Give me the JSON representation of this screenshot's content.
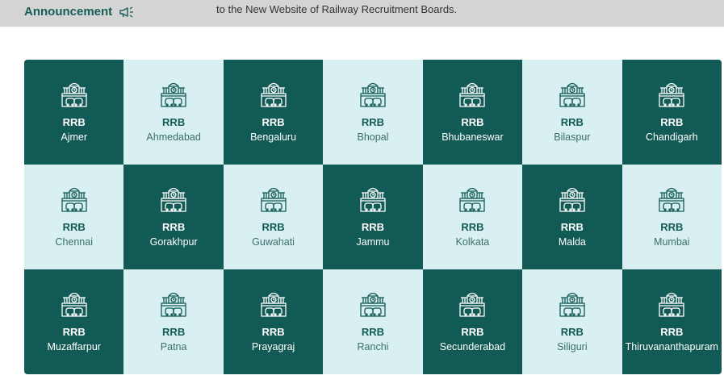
{
  "announcement": {
    "title": "Announcement",
    "icon": "megaphone-icon",
    "text": "to the New Website of Railway Recruitment Boards."
  },
  "colors": {
    "dark": "#125a55",
    "light": "#d9f0f2",
    "accent": "#165e56"
  },
  "boards": [
    {
      "prefix": "RRB",
      "city": "Ajmer",
      "theme": "dark"
    },
    {
      "prefix": "RRB",
      "city": "Ahmedabad",
      "theme": "light"
    },
    {
      "prefix": "RRB",
      "city": "Bengaluru",
      "theme": "dark"
    },
    {
      "prefix": "RRB",
      "city": "Bhopal",
      "theme": "light"
    },
    {
      "prefix": "RRB",
      "city": "Bhubaneswar",
      "theme": "dark"
    },
    {
      "prefix": "RRB",
      "city": "Bilaspur",
      "theme": "light"
    },
    {
      "prefix": "RRB",
      "city": "Chandigarh",
      "theme": "dark"
    },
    {
      "prefix": "RRB",
      "city": "Chennai",
      "theme": "light"
    },
    {
      "prefix": "RRB",
      "city": "Gorakhpur",
      "theme": "dark"
    },
    {
      "prefix": "RRB",
      "city": "Guwahati",
      "theme": "light"
    },
    {
      "prefix": "RRB",
      "city": "Jammu",
      "theme": "dark"
    },
    {
      "prefix": "RRB",
      "city": "Kolkata",
      "theme": "light"
    },
    {
      "prefix": "RRB",
      "city": "Malda",
      "theme": "dark"
    },
    {
      "prefix": "RRB",
      "city": "Mumbai",
      "theme": "light"
    },
    {
      "prefix": "RRB",
      "city": "Muzaffarpur",
      "theme": "dark"
    },
    {
      "prefix": "RRB",
      "city": "Patna",
      "theme": "light"
    },
    {
      "prefix": "RRB",
      "city": "Prayagraj",
      "theme": "dark"
    },
    {
      "prefix": "RRB",
      "city": "Ranchi",
      "theme": "light"
    },
    {
      "prefix": "RRB",
      "city": "Secunderabad",
      "theme": "dark"
    },
    {
      "prefix": "RRB",
      "city": "Siliguri",
      "theme": "light"
    },
    {
      "prefix": "RRB",
      "city": "Thiruvananthapuram",
      "theme": "dark"
    }
  ],
  "board_icon": "railway-station-icon"
}
